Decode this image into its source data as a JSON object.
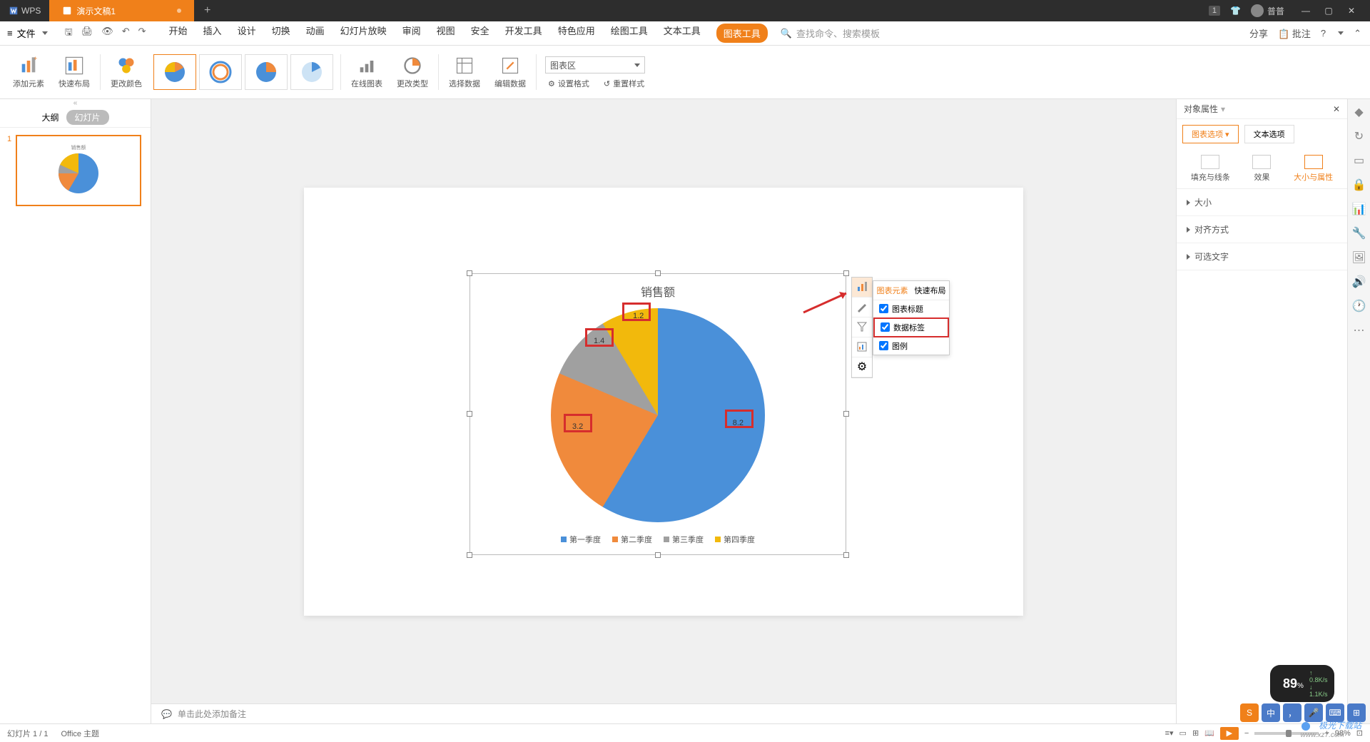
{
  "titlebar": {
    "app": "WPS",
    "doc": "演示文稿1",
    "badge": "1",
    "user": "普普"
  },
  "menubar": {
    "file": "文件",
    "tabs": [
      "开始",
      "插入",
      "设计",
      "切换",
      "动画",
      "幻灯片放映",
      "审阅",
      "视图",
      "安全",
      "开发工具",
      "特色应用",
      "绘图工具",
      "文本工具",
      "图表工具"
    ],
    "active_tab": "图表工具",
    "search_placeholder": "查找命令、搜索模板",
    "share": "分享",
    "comment": "批注"
  },
  "ribbon": {
    "add_element": "添加元素",
    "quick_layout": "快速布局",
    "change_color": "更改颜色",
    "online_chart": "在线图表",
    "change_type": "更改类型",
    "select_data": "选择数据",
    "edit_data": "编辑数据",
    "area_dropdown": "图表区",
    "set_format": "设置格式",
    "reset_style": "重置样式"
  },
  "thumbs": {
    "outline": "大纲",
    "slides": "幻灯片",
    "num": "1"
  },
  "chart_data": {
    "type": "pie",
    "title": "销售额",
    "categories": [
      "第一季度",
      "第二季度",
      "第三季度",
      "第四季度"
    ],
    "values": [
      8.2,
      3.2,
      1.4,
      1.2
    ],
    "colors": [
      "#4a90d9",
      "#f08a3c",
      "#a0a0a0",
      "#f2b90c"
    ]
  },
  "chart_popup": {
    "tab_elements": "图表元素",
    "tab_layout": "快速布局",
    "item_title": "图表标题",
    "item_labels": "数据标签",
    "item_legend": "图例"
  },
  "props": {
    "header": "对象属性",
    "tab_chart": "图表选项",
    "tab_text": "文本选项",
    "sub_fill": "填充与线条",
    "sub_effect": "效果",
    "sub_size": "大小与属性",
    "sec_size": "大小",
    "sec_align": "对齐方式",
    "sec_alt": "可选文字"
  },
  "notes_placeholder": "单击此处添加备注",
  "status": {
    "slide_count": "幻灯片 1 / 1",
    "theme": "Office 主题",
    "zoom": "98%"
  },
  "battery": {
    "pct": "89",
    "up": "0.8K/s",
    "down": "1.1K/s"
  },
  "watermark": "极光下载站",
  "watermark_url": "www.xz7.com"
}
